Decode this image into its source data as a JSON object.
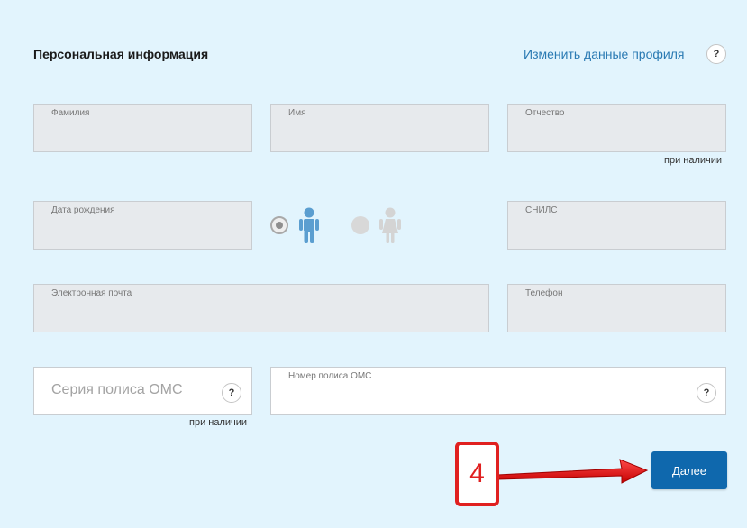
{
  "header": {
    "title": "Персональная информация",
    "edit_link": "Изменить данные профиля",
    "help": "?"
  },
  "fields": {
    "last_name": {
      "label": "Фамилия"
    },
    "first_name": {
      "label": "Имя"
    },
    "patronymic": {
      "label": "Отчество",
      "note": "при наличии"
    },
    "birth_date": {
      "label": "Дата рождения"
    },
    "snils": {
      "label": "СНИЛС"
    },
    "email": {
      "label": "Электронная почта"
    },
    "phone": {
      "label": "Телефон"
    },
    "oms_series": {
      "placeholder": "Серия полиса ОМС",
      "note": "при наличии",
      "help": "?"
    },
    "oms_number": {
      "label": "Номер полиса ОМС",
      "help": "?"
    }
  },
  "gender": {
    "selected": "male",
    "options": [
      "male",
      "female"
    ],
    "colors": {
      "male": "#5b9ed0",
      "female": "#d4d4d4"
    }
  },
  "actions": {
    "next_label": "Далее"
  },
  "annotation": {
    "step_number": "4",
    "color": "#e02020"
  },
  "colors": {
    "background": "#e2f4fd",
    "button": "#0f68ad",
    "link": "#2a7ab3"
  }
}
